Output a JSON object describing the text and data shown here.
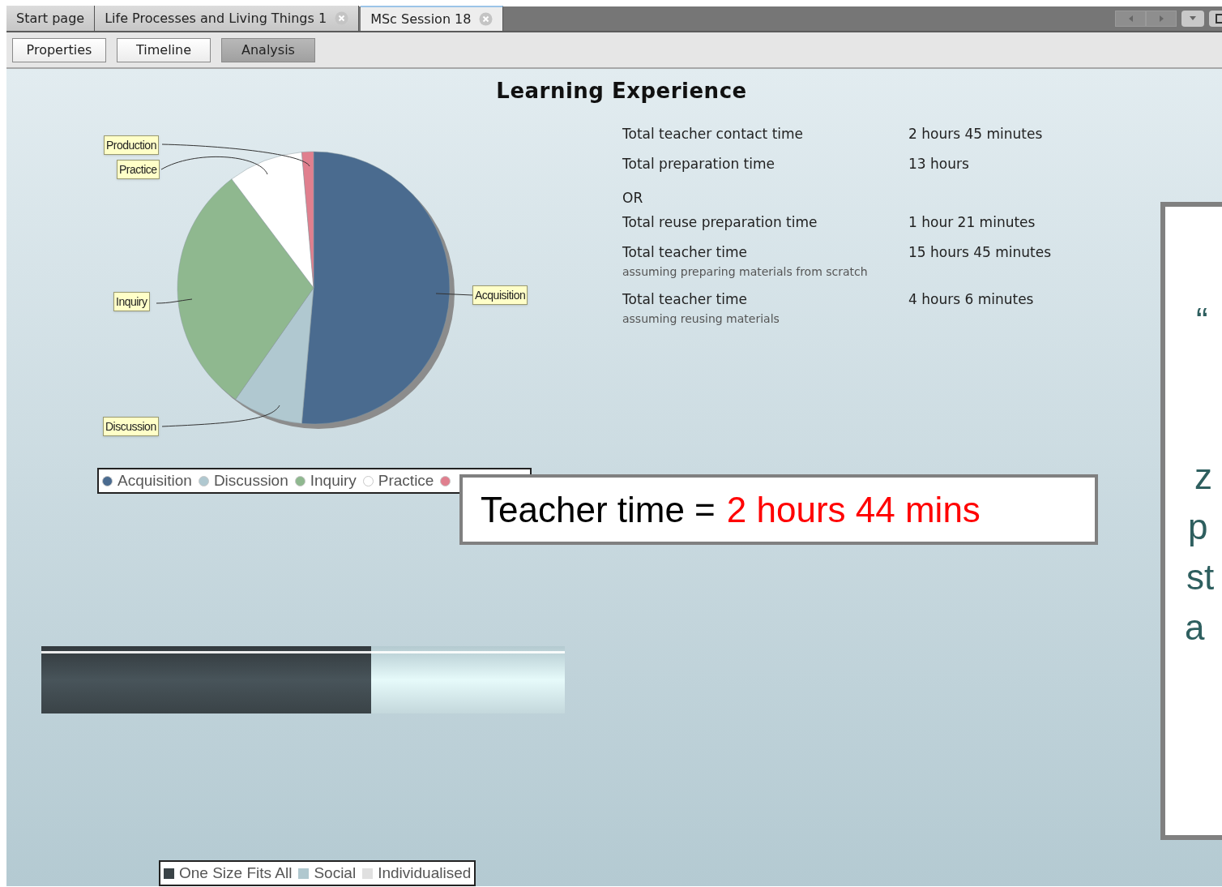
{
  "tabs": [
    {
      "label": "Start page",
      "closable": false,
      "selected": false
    },
    {
      "label": "Life Processes and Living Things 1",
      "closable": true,
      "selected": false
    },
    {
      "label": "MSc Session 18",
      "closable": true,
      "selected": true
    }
  ],
  "view_buttons": [
    {
      "label": "Properties",
      "selected": false
    },
    {
      "label": "Timeline",
      "selected": false
    },
    {
      "label": "Analysis",
      "selected": true
    }
  ],
  "title": "Learning Experience",
  "pie": {
    "labels": [
      "Production",
      "Practice",
      "Inquiry",
      "Acquisition",
      "Discussion"
    ]
  },
  "pie_legend": [
    {
      "label": "Acquisition",
      "color": "#4a6b8f"
    },
    {
      "label": "Discussion",
      "color": "#b0c8d0"
    },
    {
      "label": "Inquiry",
      "color": "#8fb88f"
    },
    {
      "label": "Practice",
      "color": "#ffffff"
    },
    {
      "color": "#e07f8e"
    }
  ],
  "stats": [
    {
      "kind": "pair",
      "label": "Total teacher contact time",
      "value": "2 hours 45 minutes"
    },
    {
      "kind": "pair",
      "label": "Total preparation time",
      "value": "13 hours"
    },
    {
      "kind": "separator",
      "label": "OR"
    },
    {
      "kind": "pair",
      "label": "Total reuse preparation time",
      "value": "1 hour 21 minutes"
    },
    {
      "kind": "pair",
      "label": "Total teacher time",
      "note": "assuming preparing materials from scratch",
      "value": "15 hours 45 minutes"
    },
    {
      "kind": "pair",
      "label": "Total teacher time",
      "note": "assuming reusing materials",
      "value": "4 hours 6 minutes"
    }
  ],
  "callout": {
    "label": "Teacher time =",
    "value": "2 hours 44 mins"
  },
  "bar": {
    "level": 0.63
  },
  "bar_legend": [
    {
      "label": "One Size Fits All",
      "color": "#3a4347"
    },
    {
      "label": "Social",
      "color": "#b0c8cf"
    },
    {
      "label": "Individualised",
      "color": "#e0e0e0"
    }
  ],
  "side_slide": {
    "lines": [
      "“",
      "z",
      "p",
      "st",
      "a"
    ]
  }
}
